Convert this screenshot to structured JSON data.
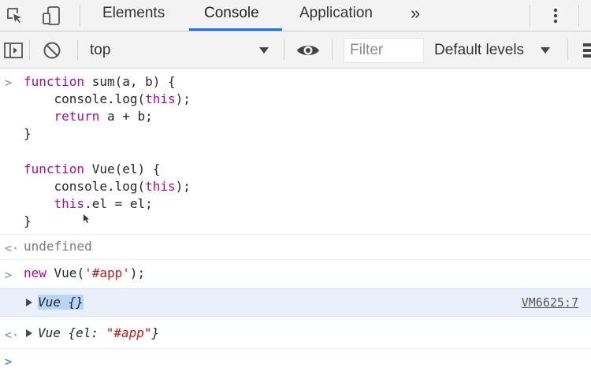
{
  "tabs": {
    "elements": "Elements",
    "console": "Console",
    "application": "Application",
    "more": "»"
  },
  "toolbar": {
    "context": "top",
    "filter_placeholder": "Filter",
    "levels": "Default levels"
  },
  "console": {
    "input_1": {
      "l1": {
        "kw": "function",
        "rest": " sum(a, b) {"
      },
      "l2": {
        "pre": "    console.log(",
        "kw": "this",
        "post": ");"
      },
      "l3": {
        "pre": "    ",
        "kw": "return",
        "post": " a + b;"
      },
      "l4": "}",
      "l6": {
        "kw": "function",
        "rest": " Vue(el) {"
      },
      "l7": {
        "pre": "    console.log(",
        "kw": "this",
        "post": ");"
      },
      "l8": {
        "pre": "    ",
        "kw": "this",
        "post": ".el = el;"
      },
      "l9": "}"
    },
    "result_1": "undefined",
    "input_2": {
      "kw": "new",
      "pre": " Vue(",
      "str": "'#app'",
      "post": ");"
    },
    "log_1": {
      "text": "Vue {}",
      "source": "VM6625:7"
    },
    "result_2": {
      "pre": "Vue {el: ",
      "str": "\"#app\"",
      "post": "}"
    }
  },
  "colors": {
    "keyword": "#aa0d91",
    "string": "#c41a16",
    "accent": "#1a73e8",
    "highlight_row": "#eaf0fb"
  },
  "icons": [
    "inspect-element-icon",
    "device-toolbar-icon",
    "kebab-menu-icon",
    "sidebar-toggle-icon",
    "clear-console-icon",
    "dropdown-arrow-icon",
    "eye-icon",
    "settings-icon",
    "input-prompt-icon",
    "result-arrow-icon",
    "expand-triangle-icon"
  ]
}
